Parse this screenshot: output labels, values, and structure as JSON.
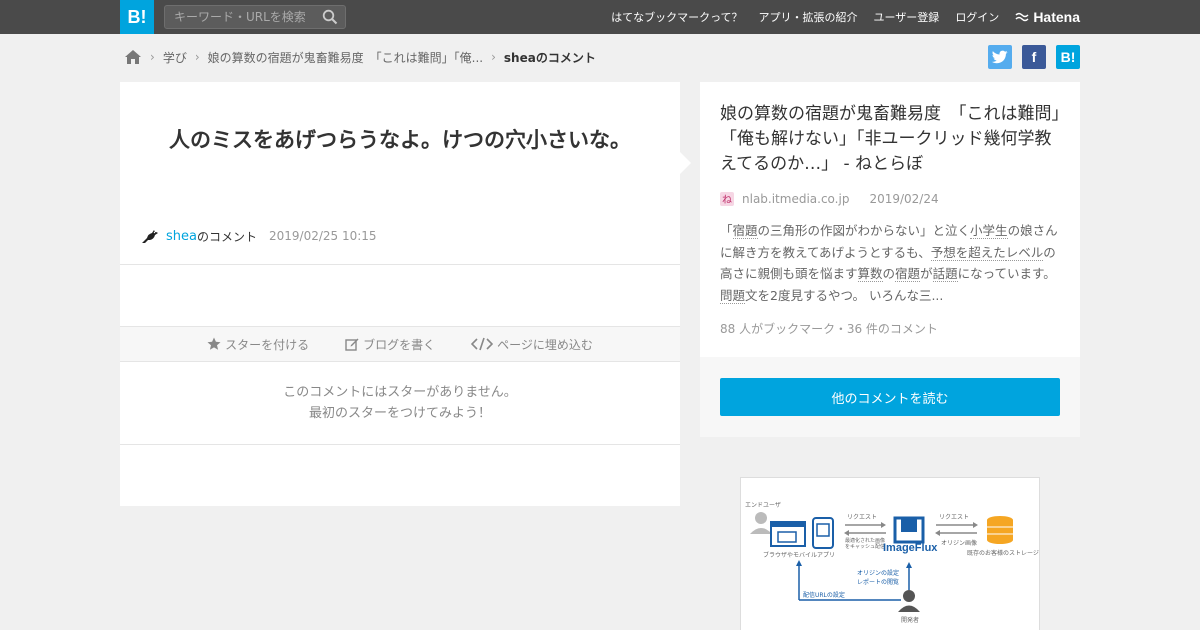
{
  "header": {
    "logo_text": "B!",
    "search_placeholder": "キーワード・URLを検索",
    "nav": [
      "はてなブックマークって？",
      "アプリ・拡張の紹介",
      "ユーザー登録",
      "ログイン"
    ],
    "brand": "Hatena"
  },
  "breadcrumb": {
    "items": [
      "学び",
      "娘の算数の宿題が鬼畜難易度　「これは難問」「俺..."
    ],
    "current": "sheaのコメント"
  },
  "share": {
    "twitter_icon": "twitter-icon",
    "facebook_label": "f",
    "hatena_label": "B!"
  },
  "comment": {
    "text": "人のミスをあげつらうなよ。けつの穴小さいな。",
    "username": "shea",
    "suffix": "のコメント",
    "timestamp": "2019/02/25 10:15"
  },
  "actions": {
    "star": "スターを付ける",
    "blog": "ブログを書く",
    "embed": "ページに埋め込む"
  },
  "no_star": {
    "line1": "このコメントにはスターがありません。",
    "line2": "最初のスターをつけてみよう！"
  },
  "entry": {
    "title": "娘の算数の宿題が鬼畜難易度　「これは難問」「俺も解けない」「非ユークリッド幾何学教えてるのか…」 - ねとらぼ",
    "domain": "nlab.itmedia.co.jp",
    "date": "2019/02/24",
    "summary_parts": [
      {
        "t": "「",
        "kw": false
      },
      {
        "t": "宿題",
        "kw": true
      },
      {
        "t": "の三角形の作図がわからない」と泣く",
        "kw": false
      },
      {
        "t": "小学生",
        "kw": true
      },
      {
        "t": "の娘さんに解き方を教えてあげようとするも、",
        "kw": false
      },
      {
        "t": "予想を超えた",
        "kw": true
      },
      {
        "t": "レベル",
        "kw": true
      },
      {
        "t": "の高さに親側も頭を悩ます",
        "kw": false
      },
      {
        "t": "算数",
        "kw": true
      },
      {
        "t": "の",
        "kw": false
      },
      {
        "t": "宿題",
        "kw": true
      },
      {
        "t": "が",
        "kw": false
      },
      {
        "t": "話題",
        "kw": true
      },
      {
        "t": "になっています",
        "kw": false
      },
      {
        "t": "。",
        "kw": false
      },
      {
        "t": "問題",
        "kw": true
      },
      {
        "t": "文を2度見するやつ。 いろんな三...",
        "kw": false
      }
    ],
    "stats": "88 人がブックマーク・36 件のコメント",
    "read_button": "他のコメントを読む"
  },
  "ad": {
    "labels": [
      "エンドユーザ",
      "リクエスト",
      "リクエスト",
      "ブラウザやモバイルアプリ",
      "最適化された画像をキャッシュ配信",
      "オリジン画像",
      "ImageFlux",
      "既存のお客様のストレージ",
      "オリジンの設定",
      "レポートの閲覧",
      "配信URLの設定",
      "開発者"
    ]
  },
  "colors": {
    "accent": "#00a4de",
    "topbar": "#4a4a4a",
    "twitter": "#55acee",
    "facebook": "#3b5998",
    "imageflux": "#1a5fa8"
  }
}
